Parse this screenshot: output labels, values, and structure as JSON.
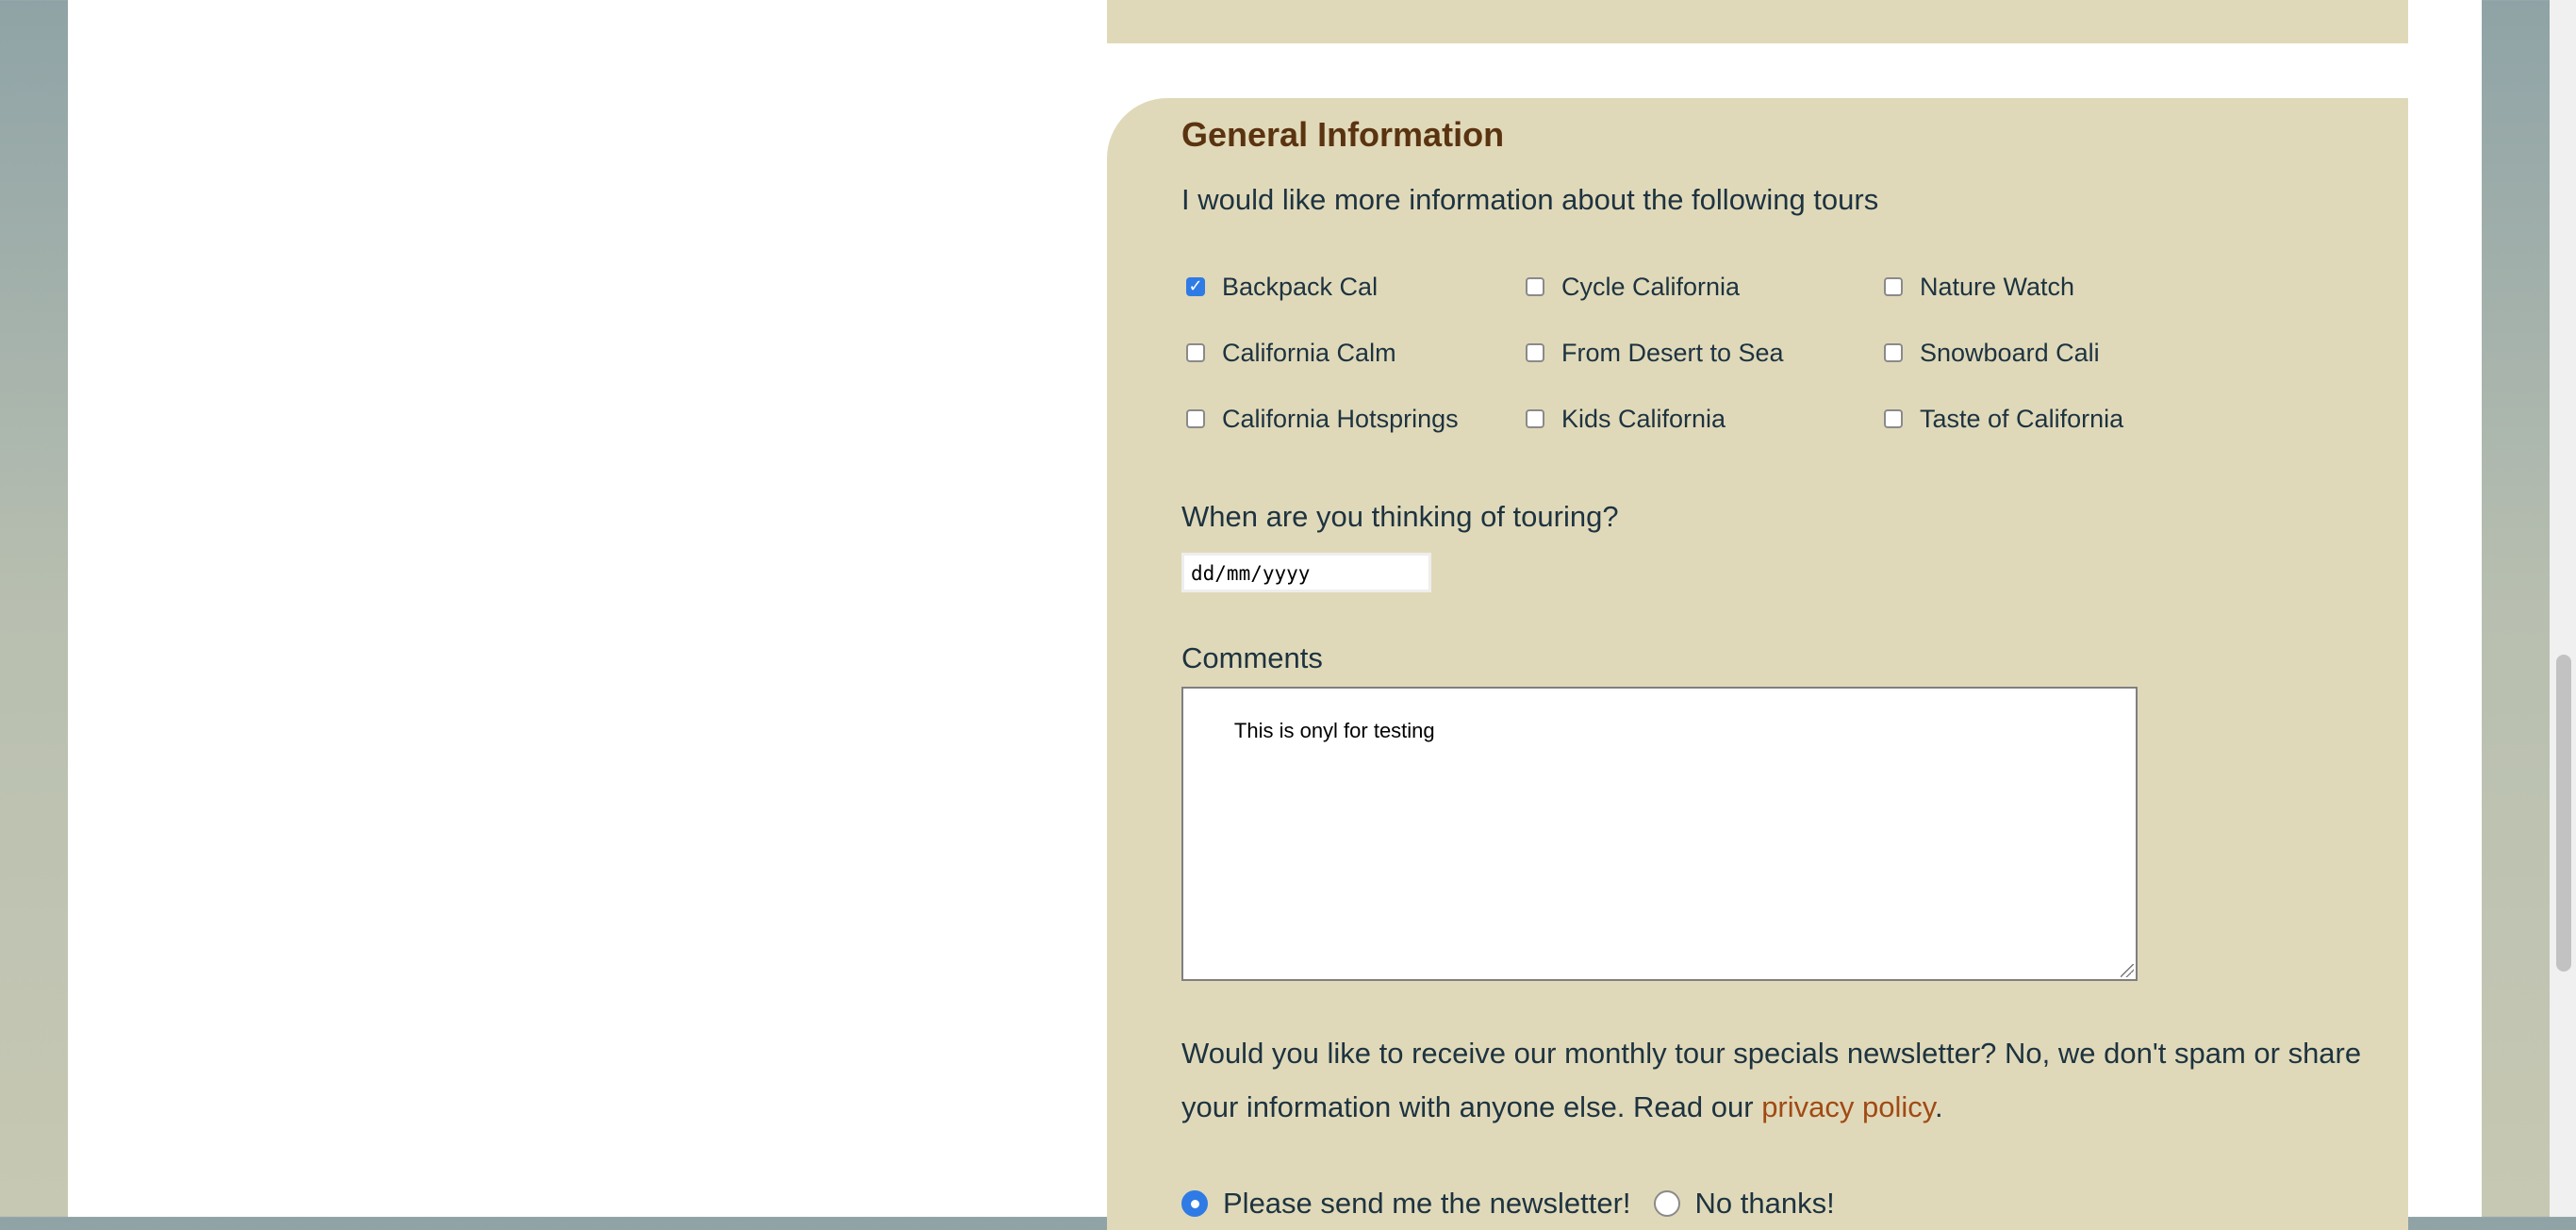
{
  "section": {
    "title": "General Information",
    "intro": "I would like more information about the following tours"
  },
  "tours": [
    {
      "label": "Backpack Cal",
      "checked": true
    },
    {
      "label": "Cycle California",
      "checked": false
    },
    {
      "label": "Nature Watch",
      "checked": false
    },
    {
      "label": "California Calm",
      "checked": false
    },
    {
      "label": "From Desert to Sea",
      "checked": false
    },
    {
      "label": "Snowboard Cali",
      "checked": false
    },
    {
      "label": "California Hotsprings",
      "checked": false
    },
    {
      "label": "Kids California",
      "checked": false
    },
    {
      "label": "Taste of California",
      "checked": false
    }
  ],
  "touring": {
    "question": "When are you thinking of touring?",
    "date_placeholder": "dd/mm/yyyy"
  },
  "comments": {
    "label": "Comments",
    "value": "This is onyl for testing"
  },
  "newsletter": {
    "text": "Would you like to receive our monthly tour specials newsletter? No, we don't spam or share your information with anyone else. Read our",
    "link": "privacy policy",
    "end": ".",
    "options": [
      {
        "label": "Please send me the newsletter!",
        "selected": true
      },
      {
        "label": "No thanks!",
        "selected": false
      }
    ]
  },
  "colors": {
    "panel": "#e0d9b9",
    "title": "#5a3310",
    "text": "#1d3340",
    "link": "#a04a14",
    "accent": "#2f7be5"
  }
}
